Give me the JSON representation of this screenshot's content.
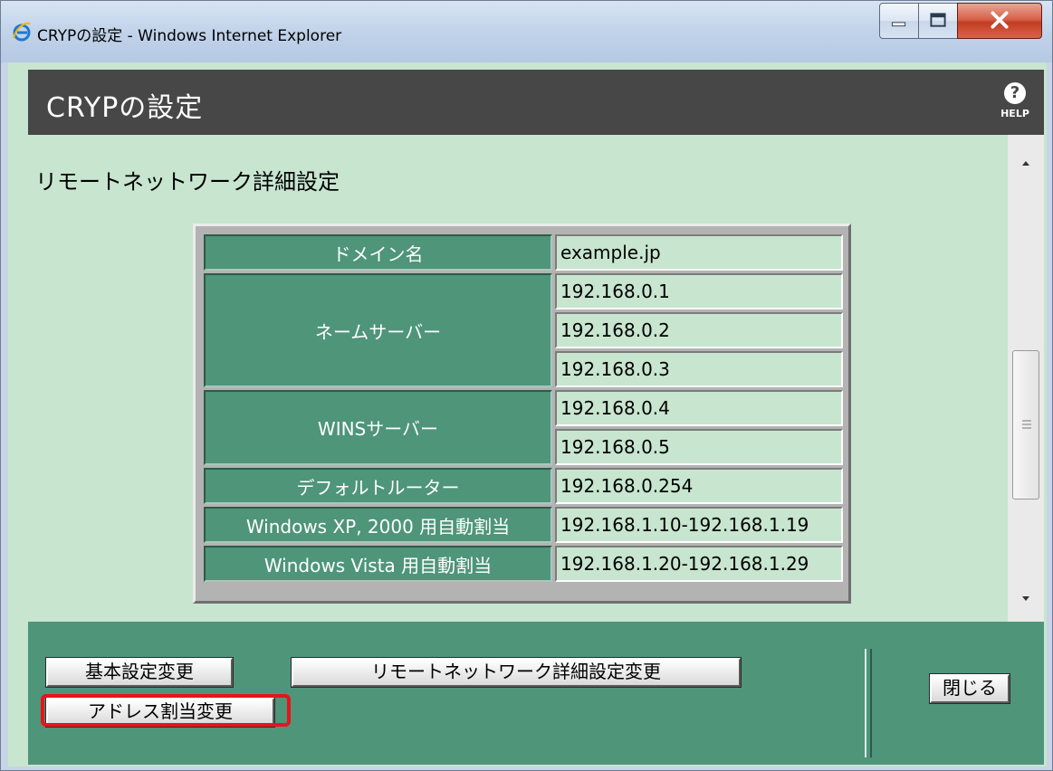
{
  "window": {
    "title": "CRYPの設定 - Windows Internet Explorer",
    "icon": "internet-explorer-icon",
    "controls": {
      "minimize_icon": "minimize-icon",
      "maximize_icon": "maximize-icon",
      "close_icon": "close-icon"
    }
  },
  "header": {
    "title": "CRYPの設定",
    "help_label": "HELP",
    "help_symbol": "?"
  },
  "section": {
    "title": "リモートネットワーク詳細設定"
  },
  "table": {
    "domain": {
      "label": "ドメイン名",
      "value": "example.jp"
    },
    "name_servers": {
      "label": "ネームサーバー",
      "values": [
        "192.168.0.1",
        "192.168.0.2",
        "192.168.0.3"
      ]
    },
    "wins_servers": {
      "label": "WINSサーバー",
      "values": [
        "192.168.0.4",
        "192.168.0.5"
      ]
    },
    "default_router": {
      "label": "デフォルトルーター",
      "value": "192.168.0.254"
    },
    "xp2000_auto": {
      "label": "Windows XP, 2000 用自動割当",
      "value": "192.168.1.10-192.168.1.19"
    },
    "vista_auto": {
      "label": "Windows Vista 用自動割当",
      "value": "192.168.1.20-192.168.1.29"
    }
  },
  "buttons": {
    "basic_settings": "基本設定変更",
    "remote_network_detail": "リモートネットワーク詳細設定変更",
    "address_assignment": "アドレス割当変更",
    "close": "閉じる"
  },
  "colors": {
    "header_bg": "#474747",
    "content_bg": "#c7e5cf",
    "table_label_bg": "#4e957a",
    "footer_bg": "#4e957a",
    "highlight": "#e8141b"
  }
}
